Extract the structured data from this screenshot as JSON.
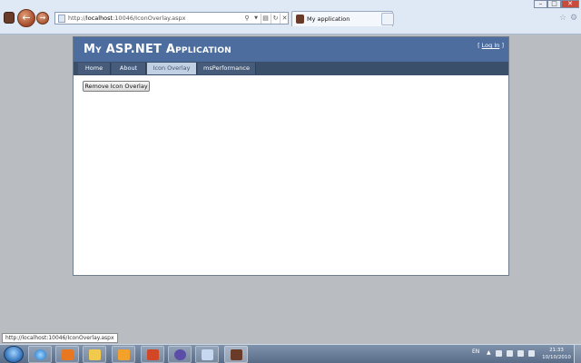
{
  "browser": {
    "address_url": "http://localhost:10046/IconOverlay.aspx",
    "address_prefix": "http://",
    "address_host": "localhost",
    "address_rest": ":10046/IconOverlay.aspx",
    "tab_title": "My application",
    "status_url": "http://localhost:10046/IconOverlay.aspx",
    "back_symbol": "←",
    "forward_symbol": "→",
    "search_symbol": "⚲",
    "dropdown_symbol": "▼",
    "refresh_symbol": "↻",
    "stop_symbol": "✕",
    "star_symbol": "☆",
    "gear_symbol": "⚙",
    "min_symbol": "–",
    "max_symbol": "□",
    "close_symbol": "✕"
  },
  "site": {
    "title": "My ASP.NET Application",
    "login_open": "[ ",
    "login_link": "Log In",
    "login_close": " ]",
    "nav": [
      {
        "label": "Home"
      },
      {
        "label": "About"
      },
      {
        "label": "Icon Overlay",
        "active": true
      },
      {
        "label": "msPerformance"
      }
    ],
    "remove_button_label": "Remove Icon Overlay",
    "colors": {
      "header": "#4c6d9e",
      "nav": "#3a4f6a",
      "active_tab": "#c2d0e3"
    }
  },
  "taskbar": {
    "apps": [
      "start-icon",
      "ie-icon",
      "media-player-icon",
      "explorer-icon",
      "outlook-icon",
      "powerpoint-icon",
      "visual-studio-icon",
      "paint-icon",
      "person-app-icon"
    ],
    "language": "EN",
    "tray_up": "▲",
    "time": "21:33",
    "date": "10/10/2010"
  }
}
